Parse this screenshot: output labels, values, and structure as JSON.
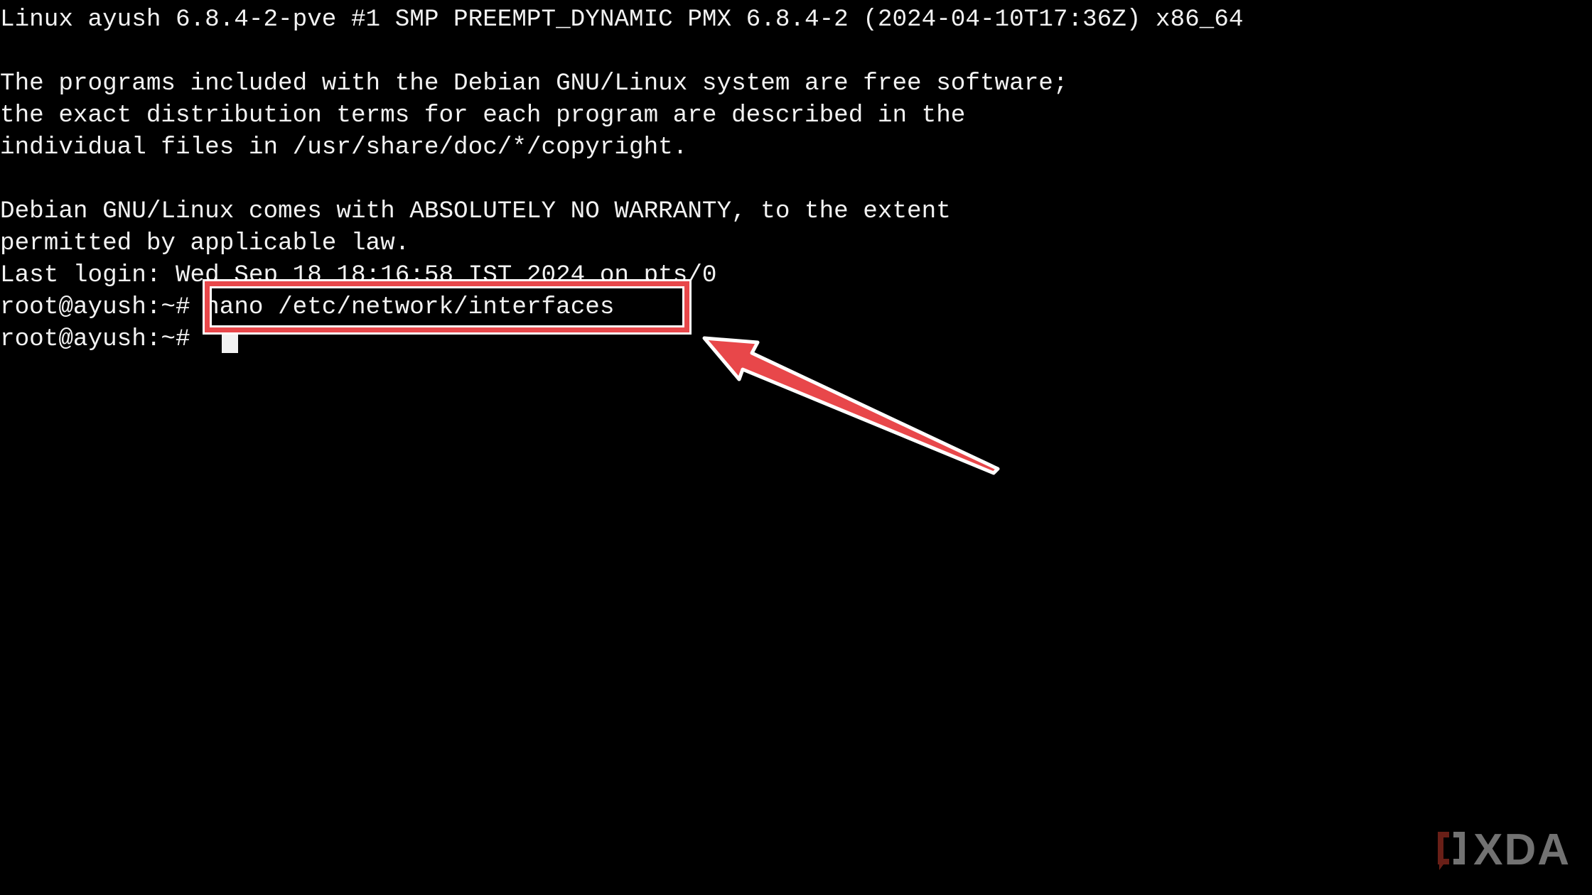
{
  "terminal": {
    "lines": [
      "Linux ayush 6.8.4-2-pve #1 SMP PREEMPT_DYNAMIC PMX 6.8.4-2 (2024-04-10T17:36Z) x86_64",
      "",
      "The programs included with the Debian GNU/Linux system are free software;",
      "the exact distribution terms for each program are described in the",
      "individual files in /usr/share/doc/*/copyright.",
      "",
      "Debian GNU/Linux comes with ABSOLUTELY NO WARRANTY, to the extent",
      "permitted by applicable law.",
      "Last login: Wed Sep 18 18:16:58 IST 2024 on pts/0"
    ],
    "prompt": "root@ayush:~# ",
    "command": "nano /etc/network/interfaces",
    "prompt2": "root@ayush:~# "
  },
  "colors": {
    "background": "#000000",
    "text": "#f2f2f2",
    "highlight": "#e8474a"
  },
  "watermark": {
    "text": "XDA",
    "icon": "xda-logo-icon"
  }
}
